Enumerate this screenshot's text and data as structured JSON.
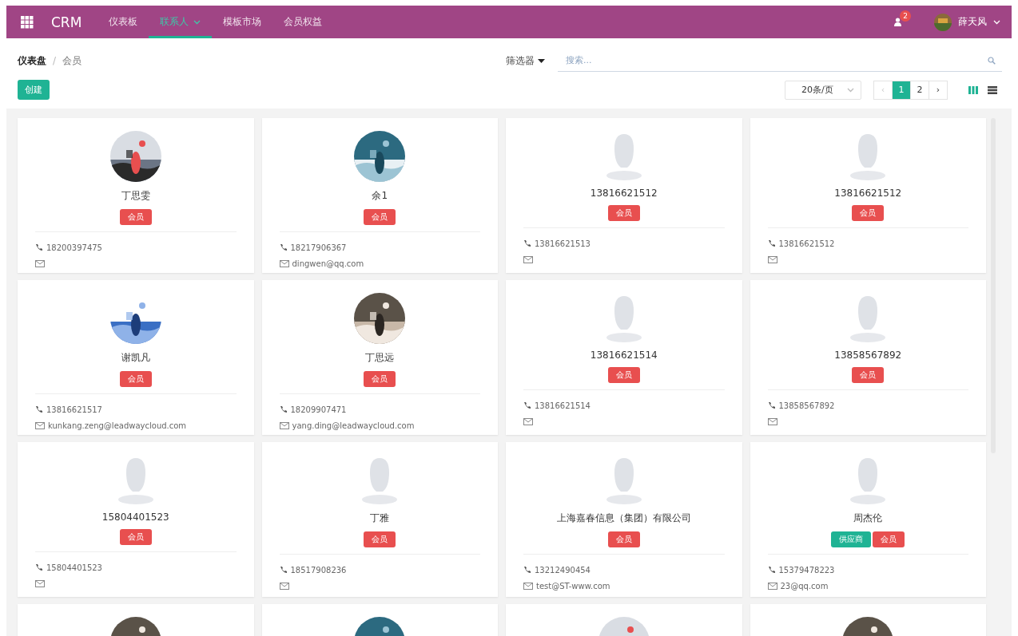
{
  "navbar": {
    "brand": "CRM",
    "menu": [
      {
        "label": "仪表板",
        "selected": false,
        "dropdown": false
      },
      {
        "label": "联系人",
        "selected": true,
        "dropdown": true
      },
      {
        "label": "模板市场",
        "selected": false,
        "dropdown": false
      },
      {
        "label": "会员权益",
        "selected": false,
        "dropdown": false
      }
    ],
    "notification_count": "2",
    "user": "薛天风"
  },
  "breadcrumb": [
    "仪表盘",
    "会员"
  ],
  "breadcrumb_separator": "/",
  "create_button": "创建",
  "filter": "筛选器",
  "search": {
    "placeholder": "搜索..."
  },
  "page_size": "20条/页",
  "pager": [
    {
      "label": "‹",
      "selected": false,
      "disabled": true
    },
    {
      "label": "1",
      "selected": true,
      "disabled": false
    },
    {
      "label": "2",
      "selected": false,
      "disabled": false
    },
    {
      "label": "›",
      "selected": false,
      "disabled": false
    }
  ],
  "views": [
    {
      "kind": "kanban",
      "selected": true
    },
    {
      "kind": "list",
      "selected": false
    }
  ],
  "cards": [
    {
      "photo": true,
      "name": "丁思雯",
      "tags": [
        {
          "label": "会员",
          "color": "#e84f4f"
        }
      ],
      "phone": "18200397475"
    },
    {
      "photo": true,
      "name": "余1",
      "tags": [
        {
          "label": "会员",
          "color": "#e84f4f"
        }
      ],
      "phone": "18217906367",
      "email": "dingwen@qq.com"
    },
    {
      "photo": false,
      "name": "13816621512",
      "tags": [
        {
          "label": "会员",
          "color": "#e84f4f"
        }
      ],
      "phone": "13816621513"
    },
    {
      "photo": false,
      "name": "13816621512",
      "tags": [
        {
          "label": "会员",
          "color": "#e84f4f"
        }
      ],
      "phone": "13816621512"
    },
    {
      "photo": true,
      "name": "谢凯凡",
      "tags": [
        {
          "label": "会员",
          "color": "#e84f4f"
        }
      ],
      "phone": "13816621517",
      "email": "kunkang.zeng@leadwaycloud.com"
    },
    {
      "photo": true,
      "name": "丁思远",
      "tags": [
        {
          "label": "会员",
          "color": "#e84f4f"
        }
      ],
      "phone": "18209907471",
      "email": "yang.ding@leadwaycloud.com"
    },
    {
      "photo": false,
      "name": "13816621514",
      "tags": [
        {
          "label": "会员",
          "color": "#e84f4f"
        }
      ],
      "phone": "13816621514"
    },
    {
      "photo": false,
      "name": "13858567892",
      "tags": [
        {
          "label": "会员",
          "color": "#e84f4f"
        }
      ],
      "phone": "13858567892"
    },
    {
      "photo": false,
      "name": "15804401523",
      "tags": [
        {
          "label": "会员",
          "color": "#e84f4f"
        }
      ],
      "phone": "15804401523"
    },
    {
      "photo": false,
      "name": "丁雅",
      "tags": [
        {
          "label": "会员",
          "color": "#e84f4f"
        }
      ],
      "phone": "18517908236"
    },
    {
      "photo": false,
      "name": "上海嘉春信息（集团）有限公司",
      "tags": [
        {
          "label": "会员",
          "color": "#e84f4f"
        }
      ],
      "phone": "13212490454",
      "email": "test@ST-www.com"
    },
    {
      "photo": false,
      "name": "周杰伦",
      "tags": [
        {
          "label": "供应商",
          "color": "#1fb394"
        },
        {
          "label": "会员",
          "color": "#e84f4f"
        }
      ],
      "phone": "15379478223",
      "email": "23@qq.com"
    },
    {
      "photo": true
    },
    {
      "photo": true
    },
    {
      "photo": true
    },
    {
      "photo": true
    }
  ]
}
